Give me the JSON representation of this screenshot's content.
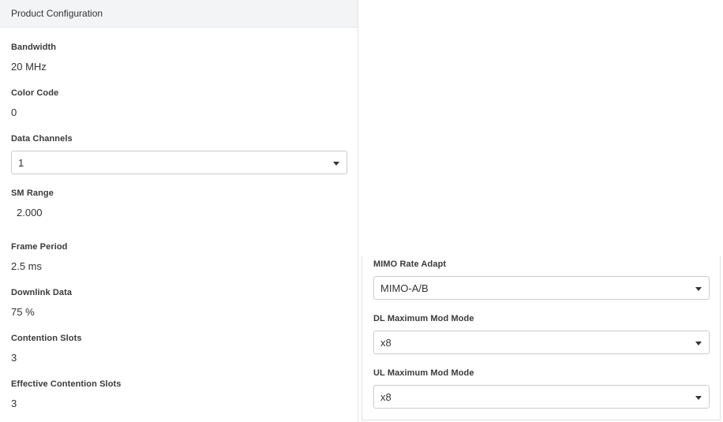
{
  "left_panel": {
    "header": "Product Configuration",
    "fields": [
      {
        "label": "Bandwidth",
        "value": "20 MHz"
      },
      {
        "label": "Color Code",
        "value": "0"
      },
      {
        "label": "Data Channels",
        "selected": "1"
      },
      {
        "label": "SM Range",
        "value": "2.000"
      },
      {
        "label": "Frame Period",
        "value": "2.5 ms"
      },
      {
        "label": "Downlink Data",
        "value": "75 %"
      },
      {
        "label": "Contention Slots",
        "value": "3"
      },
      {
        "label": "Effective Contention Slots",
        "value": "3"
      }
    ]
  },
  "right_panel": {
    "fields": [
      {
        "label": "MIMO Rate Adapt",
        "selected": "MIMO-A/B"
      },
      {
        "label": "DL Maximum Mod Mode",
        "selected": "x8"
      },
      {
        "label": "UL Maximum Mod Mode",
        "selected": "x8"
      }
    ]
  }
}
